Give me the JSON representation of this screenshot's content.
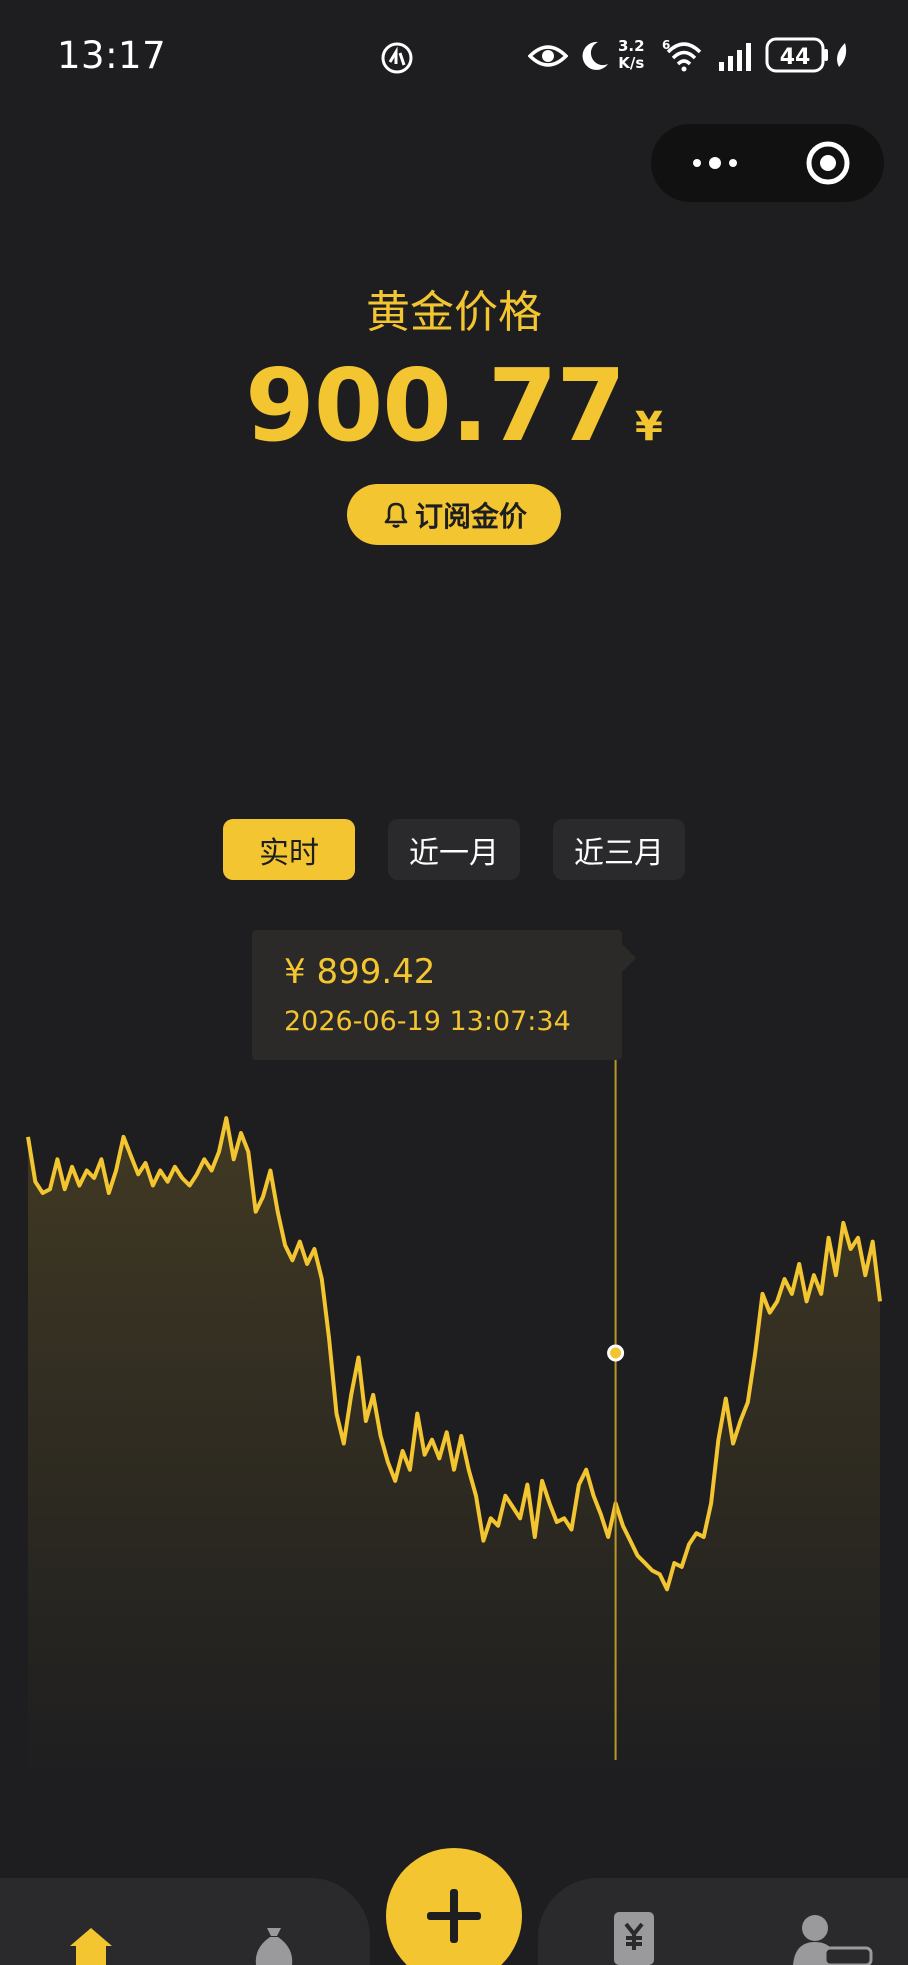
{
  "status_bar": {
    "time": "13:17",
    "net_speed_value": "3.2",
    "net_speed_unit": "K/s",
    "signal_type": "6",
    "battery": "44"
  },
  "header": {
    "title": "黄金价格",
    "price": "900.77",
    "currency": "¥",
    "subscribe_label": "订阅金价"
  },
  "tabs": [
    {
      "label": "实时",
      "active": true
    },
    {
      "label": "近一月",
      "active": false
    },
    {
      "label": "近三月",
      "active": false
    }
  ],
  "tooltip": {
    "price": "¥ 899.42",
    "time": "2026-06-19 13:07:34"
  },
  "colors": {
    "accent": "#f3c530",
    "background": "#1e1e20",
    "panel": "#2a2a2c"
  },
  "chart_data": {
    "type": "line",
    "series": [
      {
        "values": [
          905.2,
          904.0,
          903.7,
          903.8,
          904.6,
          903.8,
          904.4,
          903.9,
          904.3,
          904.1,
          904.6,
          903.7,
          904.3,
          905.2,
          904.7,
          904.2,
          904.5,
          903.9,
          904.3,
          904.0,
          904.4,
          904.1,
          903.9,
          904.2,
          904.6,
          904.3,
          904.8,
          905.7,
          904.6,
          905.3,
          904.8,
          903.2,
          903.6,
          904.3,
          903.2,
          902.3,
          901.9,
          902.4,
          901.8,
          902.2,
          901.4,
          899.8,
          897.8,
          897.0,
          898.3,
          899.3,
          897.6,
          898.3,
          897.2,
          896.5,
          896.0,
          896.8,
          896.3,
          897.8,
          896.7,
          897.1,
          896.6,
          897.3,
          896.3,
          897.2,
          896.3,
          895.6,
          894.4,
          895.0,
          894.8,
          895.6,
          895.3,
          895.0,
          895.9,
          894.5,
          896.0,
          895.4,
          894.9,
          895.0,
          894.7,
          895.9,
          896.3,
          895.6,
          895.1,
          894.5,
          895.4,
          894.8,
          894.4,
          894.0,
          893.8,
          893.6,
          893.5,
          893.1,
          893.8,
          893.7,
          894.3,
          894.6,
          894.5,
          895.4,
          897.1,
          898.2,
          897.0,
          897.6,
          898.1,
          899.4,
          901.0,
          900.5,
          900.8,
          901.4,
          901.0,
          901.8,
          900.8,
          901.5,
          901.0,
          902.5,
          901.5,
          902.9,
          902.2,
          902.5,
          901.5,
          902.4,
          900.8
        ]
      }
    ],
    "tooltip": {
      "price": 899.42,
      "time": "2026-06-19 13:07:34"
    },
    "selected_index": 80,
    "ylim": [
      888,
      911
    ],
    "grid": false
  }
}
